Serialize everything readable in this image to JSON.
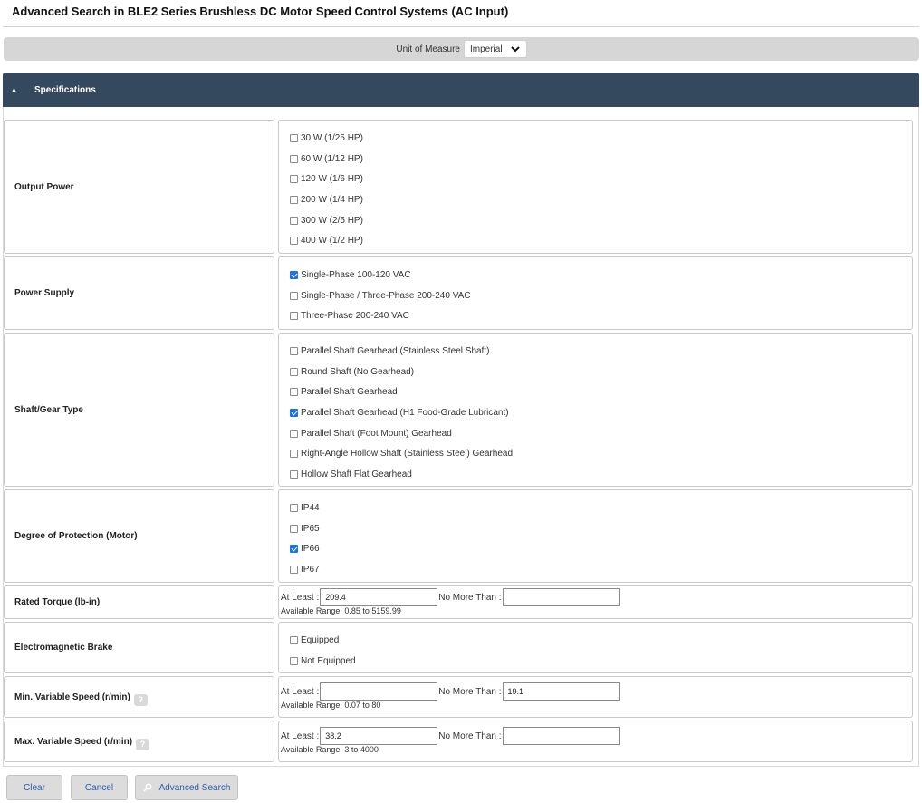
{
  "page": {
    "title": "Advanced Search in BLE2 Series Brushless DC Motor Speed Control Systems (AC Input)"
  },
  "unit_of_measure": {
    "label": "Unit of Measure",
    "selected": "Imperial"
  },
  "specifications": {
    "header": "Specifications"
  },
  "rows": {
    "output_power": {
      "label": "Output Power",
      "options": [
        {
          "label": "30 W (1/25 HP)",
          "checked": false
        },
        {
          "label": "60 W (1/12 HP)",
          "checked": false
        },
        {
          "label": "120 W (1/6 HP)",
          "checked": false
        },
        {
          "label": "200 W (1/4 HP)",
          "checked": false
        },
        {
          "label": "300 W (2/5 HP)",
          "checked": false
        },
        {
          "label": "400 W (1/2 HP)",
          "checked": false
        }
      ]
    },
    "power_supply": {
      "label": "Power Supply",
      "options": [
        {
          "label": "Single-Phase 100-120 VAC",
          "checked": true
        },
        {
          "label": "Single-Phase / Three-Phase 200-240 VAC",
          "checked": false
        },
        {
          "label": "Three-Phase 200-240 VAC",
          "checked": false
        }
      ]
    },
    "shaft_gear": {
      "label": "Shaft/Gear Type",
      "options": [
        {
          "label": "Parallel Shaft Gearhead (Stainless Steel Shaft)",
          "checked": false
        },
        {
          "label": "Round Shaft (No Gearhead)",
          "checked": false
        },
        {
          "label": "Parallel Shaft Gearhead",
          "checked": false
        },
        {
          "label": "Parallel Shaft Gearhead (H1 Food-Grade Lubricant)",
          "checked": true
        },
        {
          "label": "Parallel Shaft (Foot Mount) Gearhead",
          "checked": false
        },
        {
          "label": "Right-Angle Hollow Shaft (Stainless Steel) Gearhead",
          "checked": false
        },
        {
          "label": "Hollow Shaft Flat Gearhead",
          "checked": false
        }
      ]
    },
    "protection": {
      "label": "Degree of Protection (Motor)",
      "options": [
        {
          "label": "IP44",
          "checked": false
        },
        {
          "label": "IP65",
          "checked": false
        },
        {
          "label": "IP66",
          "checked": true
        },
        {
          "label": "IP67",
          "checked": false
        }
      ]
    },
    "rated_torque": {
      "label": "Rated Torque (lb-in)",
      "at_least_label": "At Least :",
      "at_least_value": "209.4",
      "no_more_label": "No More Than :",
      "no_more_value": "",
      "available": "Available Range: 0.85 to 5159.99"
    },
    "brake": {
      "label": "Electromagnetic Brake",
      "options": [
        {
          "label": "Equipped",
          "checked": false
        },
        {
          "label": "Not Equipped",
          "checked": false
        }
      ]
    },
    "min_speed": {
      "label": "Min. Variable Speed (r/min)",
      "help": "?",
      "at_least_label": "At Least :",
      "at_least_value": "",
      "no_more_label": "No More Than :",
      "no_more_value": "19.1",
      "available": "Available Range: 0.07 to 80"
    },
    "max_speed": {
      "label": "Max. Variable Speed (r/min)",
      "help": "?",
      "at_least_label": "At Least :",
      "at_least_value": "38.2",
      "no_more_label": "No More Than :",
      "no_more_value": "",
      "available": "Available Range: 3 to 4000"
    }
  },
  "buttons": {
    "clear": "Clear",
    "cancel": "Cancel",
    "advanced_search": "Advanced Search"
  },
  "colors": {
    "header_bg": "#34495e",
    "button_text": "#2a5da8",
    "checkbox_checked": "#1a73e8"
  }
}
